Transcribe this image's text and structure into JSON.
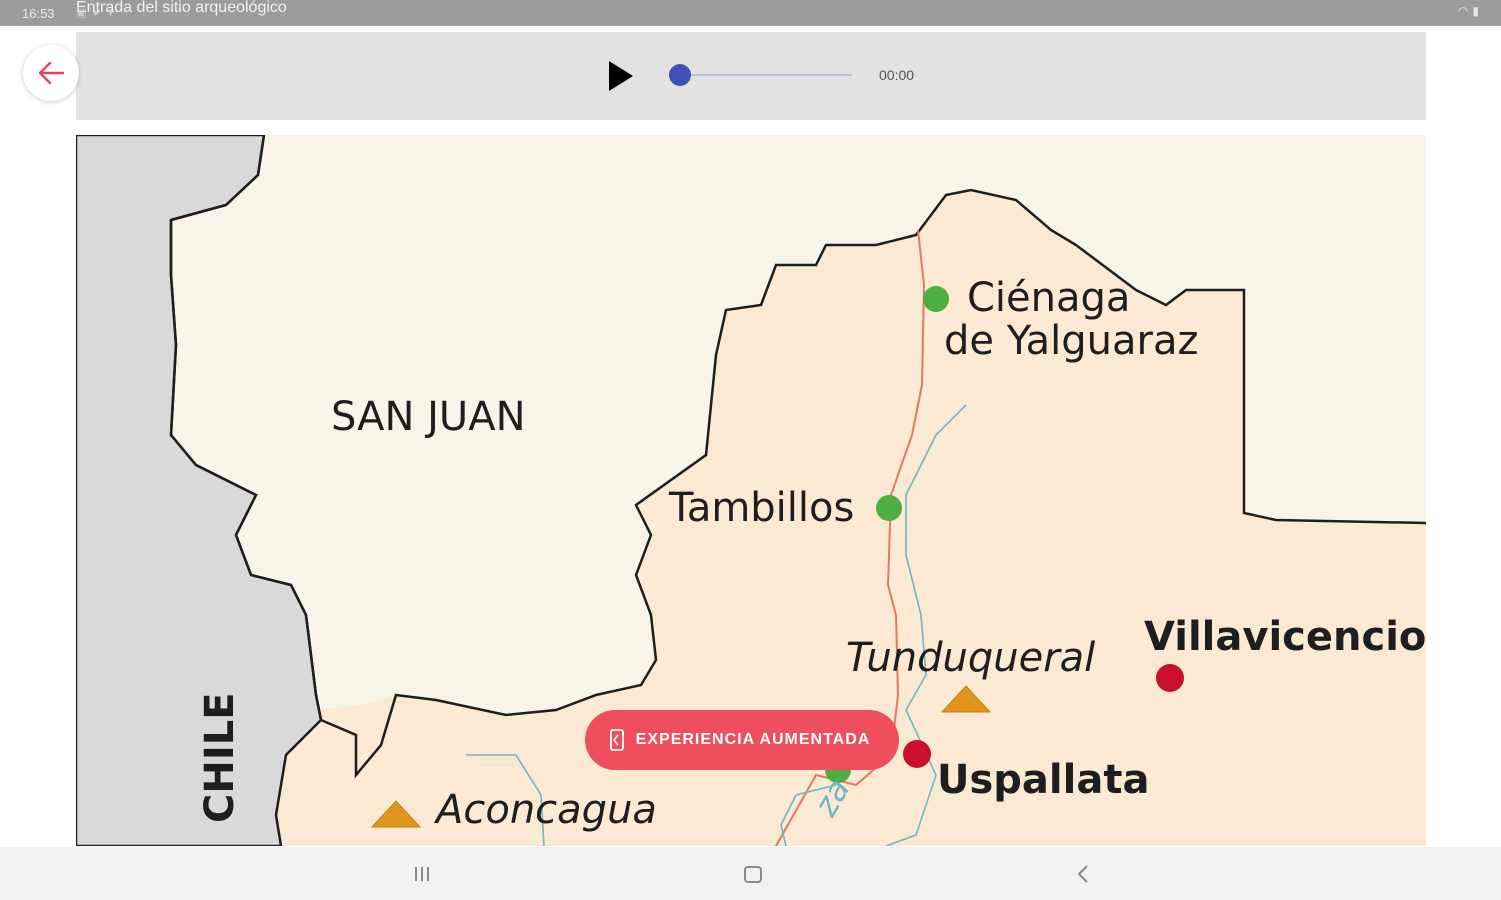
{
  "status_bar": {
    "time": "16:53",
    "title": "Entrada del sitio arqueológico",
    "left_icons": [
      "image-icon",
      "notification-icon",
      "download-icon"
    ],
    "right_icons": [
      "wifi-icon",
      "battery-icon"
    ]
  },
  "audio_player": {
    "time": "00:00",
    "progress": 0,
    "accent_color": "#3f51b5"
  },
  "map": {
    "labels": {
      "san_juan": "SAN JUAN",
      "chile": "CHILE",
      "cienaga_line1": "Ciénaga",
      "cienaga_line2": "de Yalguaraz",
      "tambillos": "Tambillos",
      "tunduqueral": "Tunduqueral",
      "villavicencio": "Villavicencio",
      "uspallata": "Uspallata",
      "aconcagua": "Aconcagua",
      "river": "za"
    },
    "colors": {
      "green_site": "#4caf3f",
      "red_site": "#c8102e",
      "peak": "#e0961e",
      "road": "#e07a5f",
      "river": "#6cb8c4",
      "mendoza_fill": "#fbe9d4",
      "san_juan_fill": "#f8f4ea",
      "chile_fill": "#d9d9d9"
    }
  },
  "cta": {
    "label": "EXPERIENCIA AUMENTADA",
    "color": "#ef4f5c"
  },
  "nav_bar": {
    "icons": [
      "recent-apps-icon",
      "home-icon",
      "back-nav-icon"
    ]
  }
}
